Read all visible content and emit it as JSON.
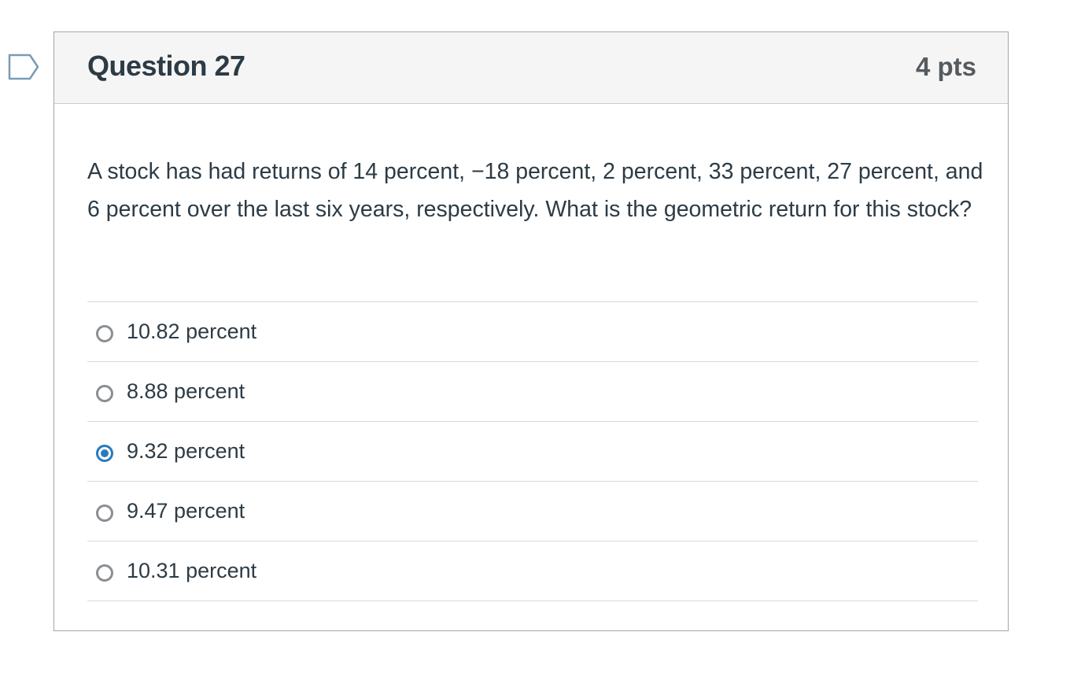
{
  "question": {
    "title": "Question 27",
    "points": "4 pts",
    "text": "A stock has had returns of 14 percent, −18 percent, 2 percent, 33 percent, 27 percent, and 6 percent over the last six years, respectively. What is the geometric return for this stock?",
    "flag_icon": "flag-question-icon",
    "answers": [
      {
        "label": "10.82 percent",
        "selected": false
      },
      {
        "label": "8.88 percent",
        "selected": false
      },
      {
        "label": "9.32 percent",
        "selected": true
      },
      {
        "label": "9.47 percent",
        "selected": false
      },
      {
        "label": "10.31 percent",
        "selected": false
      }
    ]
  },
  "colors": {
    "accent": "#2b7abc",
    "header_bg": "#f5f5f5",
    "text": "#2d3b45",
    "border": "#a5a5a5"
  }
}
